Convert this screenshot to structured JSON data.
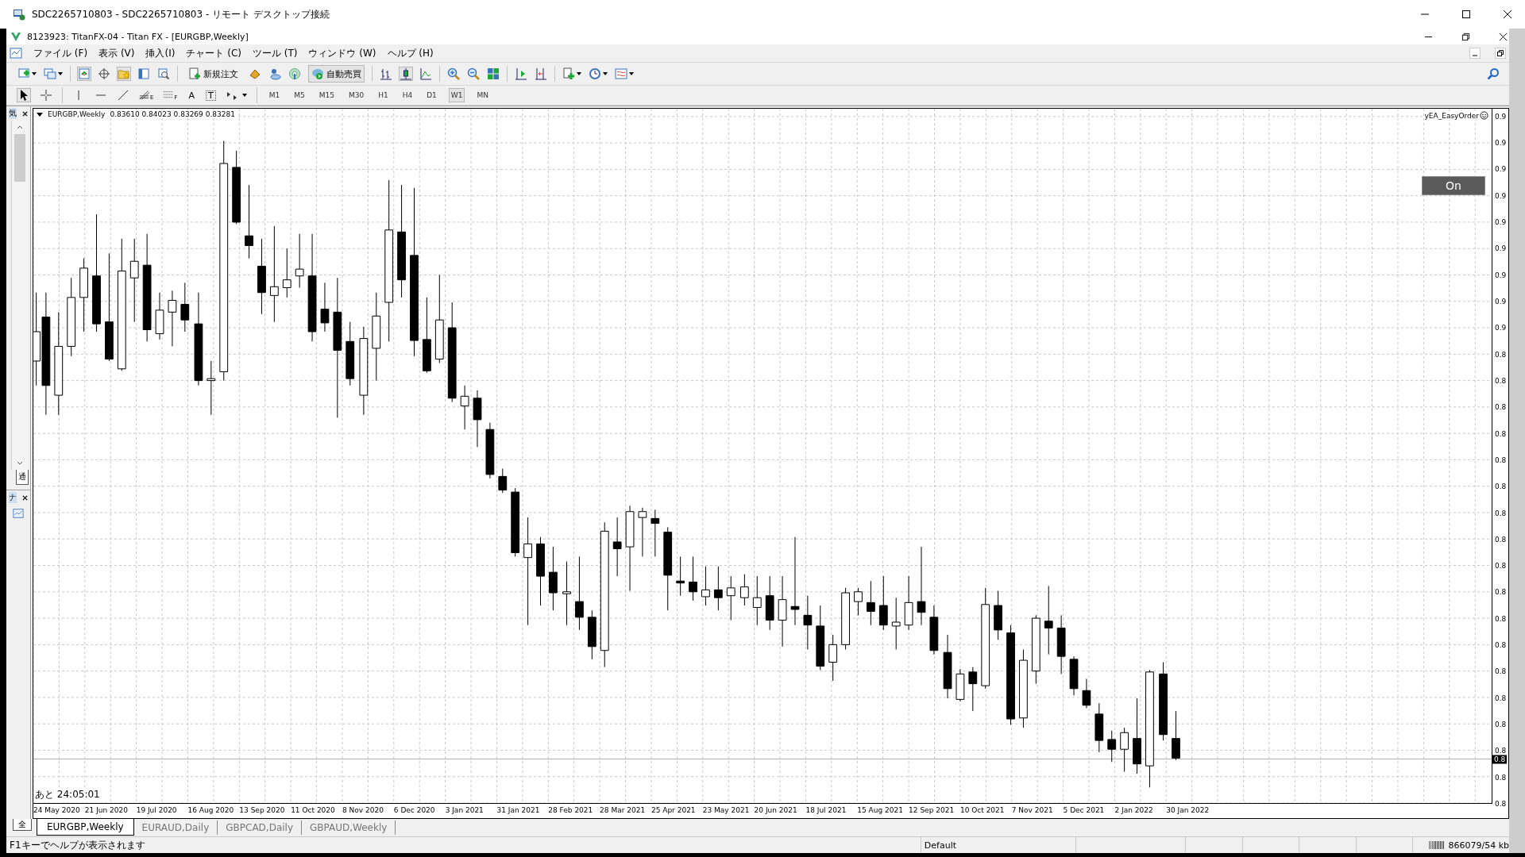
{
  "remote_window": {
    "title": "SDC2265710803 - SDC2265710803 - リモート デスクトップ接続"
  },
  "app_window": {
    "title": "8123923: TitanFX-04 - Titan FX - [EURGBP,Weekly]"
  },
  "menu": [
    {
      "label": "ファイル (F)"
    },
    {
      "label": "表示 (V)"
    },
    {
      "label": "挿入(I)"
    },
    {
      "label": "チャート (C)"
    },
    {
      "label": "ツール (T)"
    },
    {
      "label": "ウィンドウ (W)"
    },
    {
      "label": "ヘルプ (H)"
    }
  ],
  "toolbar": {
    "new_order": "新規注文",
    "auto_trading": {
      "label": "自動売買",
      "on": true
    }
  },
  "drawing_tools": {
    "fibo_fan_mark": "E",
    "fibo_levels_mark": "F",
    "text_tool": "A",
    "label_tool": "T"
  },
  "timeframes": [
    {
      "label": "M1",
      "selected": false
    },
    {
      "label": "M5",
      "selected": false
    },
    {
      "label": "M15",
      "selected": false
    },
    {
      "label": "M30",
      "selected": false
    },
    {
      "label": "H1",
      "selected": false
    },
    {
      "label": "H4",
      "selected": false
    },
    {
      "label": "D1",
      "selected": false
    },
    {
      "label": "W1",
      "selected": true
    },
    {
      "label": "MN",
      "selected": false
    }
  ],
  "side_panels": {
    "market_watch_title": "気",
    "market_watch_tab": "通",
    "navigator_title": "ナ"
  },
  "chart": {
    "symbol": "EURGBP,Weekly",
    "quote": "0.83610 0.84023 0.83269 0.83281",
    "expert": "yEA_EasyOrder",
    "expert_button": "On",
    "countdown": "あと 24:05:01",
    "price_labels": [
      "0.9",
      "0.9",
      "0.9",
      "0.9",
      "0.9",
      "0.9",
      "0.9",
      "0.9",
      "0.9",
      "0.8",
      "0.8",
      "0.8",
      "0.8",
      "0.8",
      "0.8",
      "0.8",
      "0.8",
      "0.8",
      "0.8",
      "0.8",
      "0.8",
      "0.8",
      "0.8",
      "0.8",
      "0.8",
      "0.8",
      "0.8"
    ],
    "current_price": "0.8",
    "date_labels": [
      "24 May 2020",
      "21 Jun 2020",
      "19 Jul 2020",
      "16 Aug 2020",
      "13 Sep 2020",
      "11 Oct 2020",
      "8 Nov 2020",
      "6 Dec 2020",
      "3 Jan 2021",
      "31 Jan 2021",
      "28 Feb 2021",
      "28 Mar 2021",
      "25 Apr 2021",
      "23 May 2021",
      "20 Jun 2021",
      "18 Jul 2021",
      "15 Aug 2021",
      "12 Sep 2021",
      "10 Oct 2021",
      "7 Nov 2021",
      "5 Dec 2021",
      "2 Jan 2022",
      "30 Jan 2022"
    ]
  },
  "terminal_tab": "全",
  "chart_tabs": [
    {
      "label": "EURGBP,Weekly",
      "selected": true
    },
    {
      "label": "EURAUD,Daily",
      "selected": false
    },
    {
      "label": "GBPCAD,Daily",
      "selected": false
    },
    {
      "label": "GBPAUD,Weekly",
      "selected": false
    }
  ],
  "status_bar": {
    "help": "F1キーでヘルプが表示されます",
    "profile": "Default",
    "traffic": "866079/54 kb"
  }
}
